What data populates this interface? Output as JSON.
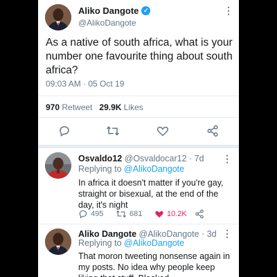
{
  "tweet": {
    "name": "Aliko Dangote",
    "handle": "@AlikoDangote",
    "text": "As a native of south africa, what is your number one favourite thing about south africa?",
    "time": "09:03 AM · 05 Oct 19",
    "retweets": "970",
    "retweets_label": "Retweet",
    "likes": "29.9K",
    "likes_label": "Likes"
  },
  "replies": [
    {
      "name": "Osvaldo12",
      "handle": "@Osvaldocar12",
      "age": "· 7d",
      "replying_prefix": "Replying to",
      "replying_to": "@AlikoDangote",
      "text": "In africa it doesn't matter if you're gay, straight or bisexual, at the end of the day, it's night",
      "replies": "495",
      "retweets": "681",
      "likes": "10.2K"
    },
    {
      "name": "Aliko Dangote",
      "handle": "@AlikoDangote",
      "age": "· 3d",
      "replying_prefix": "Replying to",
      "replying_to": "@AlikoDangote",
      "text": "That moron tweeting nonsense again in my posts. No idea why people keep liking that stuff. Blocked."
    }
  ],
  "icons": {
    "reply": "reply-icon",
    "retweet": "retweet-icon",
    "like": "heart-icon",
    "share": "share-icon",
    "verified": "verified-badge-icon",
    "more": "more-options-icon"
  },
  "colors": {
    "accent": "#1da1f2",
    "like": "#e0245e",
    "muted": "#657786"
  }
}
